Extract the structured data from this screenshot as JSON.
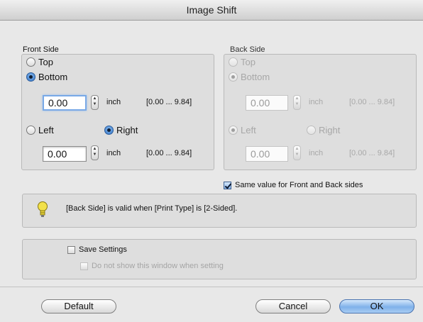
{
  "window": {
    "title": "Image Shift"
  },
  "front": {
    "label": "Front Side",
    "vertical": {
      "top": "Top",
      "bottom": "Bottom"
    },
    "vertical_value": "0.00",
    "horizontal": {
      "left": "Left",
      "right": "Right"
    },
    "horizontal_value": "0.00",
    "unit": "inch",
    "range": "[0.00 ... 9.84]"
  },
  "back": {
    "label": "Back Side",
    "vertical": {
      "top": "Top",
      "bottom": "Bottom"
    },
    "vertical_value": "0.00",
    "horizontal": {
      "left": "Left",
      "right": "Right"
    },
    "horizontal_value": "0.00",
    "unit": "inch",
    "range": "[0.00 ... 9.84]"
  },
  "same_value_label": "Same value for Front and Back sides",
  "info_text": "[Back Side] is valid when [Print Type] is [2-Sided].",
  "save_settings_label": "Save Settings",
  "dont_show_label": "Do not show this window when setting",
  "buttons": {
    "default": "Default",
    "cancel": "Cancel",
    "ok": "OK"
  },
  "colors": {
    "accent": "#2d6fc4",
    "ok_button": "#7fb1ea",
    "bulb": "#f2e14a"
  },
  "icons": {
    "info": "lightbulb-icon"
  }
}
